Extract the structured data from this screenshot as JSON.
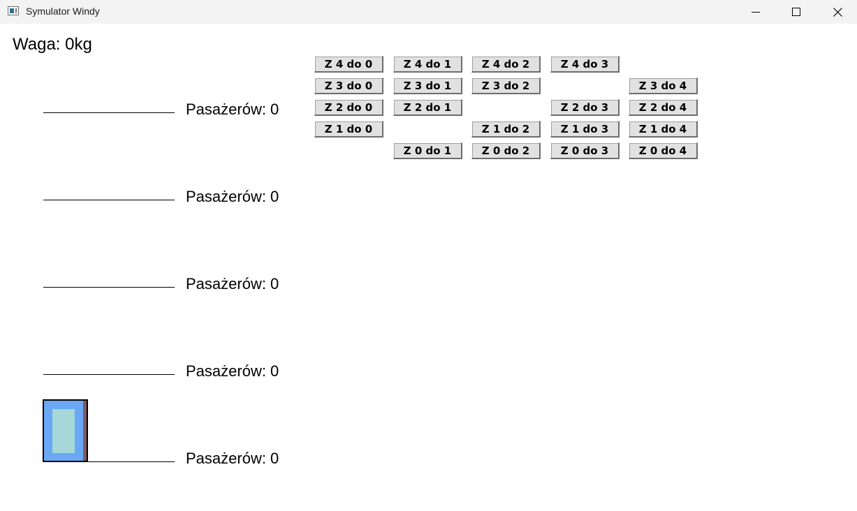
{
  "window": {
    "title": "Symulator Windy",
    "controls": [
      "minimize",
      "maximize",
      "close"
    ]
  },
  "weight_label": "Waga: 0kg",
  "floors": [
    {
      "floor": 4,
      "label": "Pasażerów: 0"
    },
    {
      "floor": 3,
      "label": "Pasażerów: 0"
    },
    {
      "floor": 2,
      "label": "Pasażerów: 0"
    },
    {
      "floor": 1,
      "label": "Pasażerów: 0"
    },
    {
      "floor": 0,
      "label": "Pasażerów: 0"
    }
  ],
  "call_buttons": [
    [
      "Z 4 do 0",
      "Z 4 do 1",
      "Z 4 do 2",
      "Z 4 do 3",
      null
    ],
    [
      "Z 3 do 0",
      "Z 3 do 1",
      "Z 3 do 2",
      null,
      "Z 3 do 4"
    ],
    [
      "Z 2 do 0",
      "Z 2 do 1",
      null,
      "Z 2 do 3",
      "Z 2 do 4"
    ],
    [
      "Z 1 do 0",
      null,
      "Z 1 do 2",
      "Z 1 do 3",
      "Z 1 do 4"
    ],
    [
      null,
      "Z 0 do 1",
      "Z 0 do 2",
      "Z 0 do 3",
      "Z 0 do 4"
    ]
  ],
  "elevator": {
    "current_floor": 0,
    "colors": {
      "body": "#6aa8f5",
      "window": "#a6d8da",
      "door": "#7d5a63"
    }
  }
}
